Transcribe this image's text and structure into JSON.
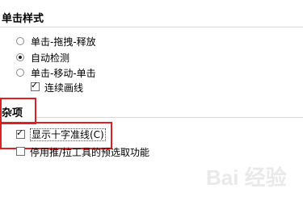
{
  "click_style": {
    "title": "单击样式",
    "options": [
      {
        "label": "单击-拖拽-释放",
        "selected": false
      },
      {
        "label": "自动检测",
        "selected": true
      },
      {
        "label": "单击-移动-单击",
        "selected": false
      }
    ],
    "continuous_line": {
      "label": "连续画线",
      "checked": true
    }
  },
  "misc": {
    "title": "杂项",
    "show_crosshair": {
      "label": "显示十字准线(C)",
      "checked": true
    },
    "disable_pick_tool": {
      "label": "停用推/拉工具的预选取功能",
      "checked": false
    }
  },
  "watermark": {
    "text": "Bai 经验"
  },
  "highlight_color": "#e02020"
}
